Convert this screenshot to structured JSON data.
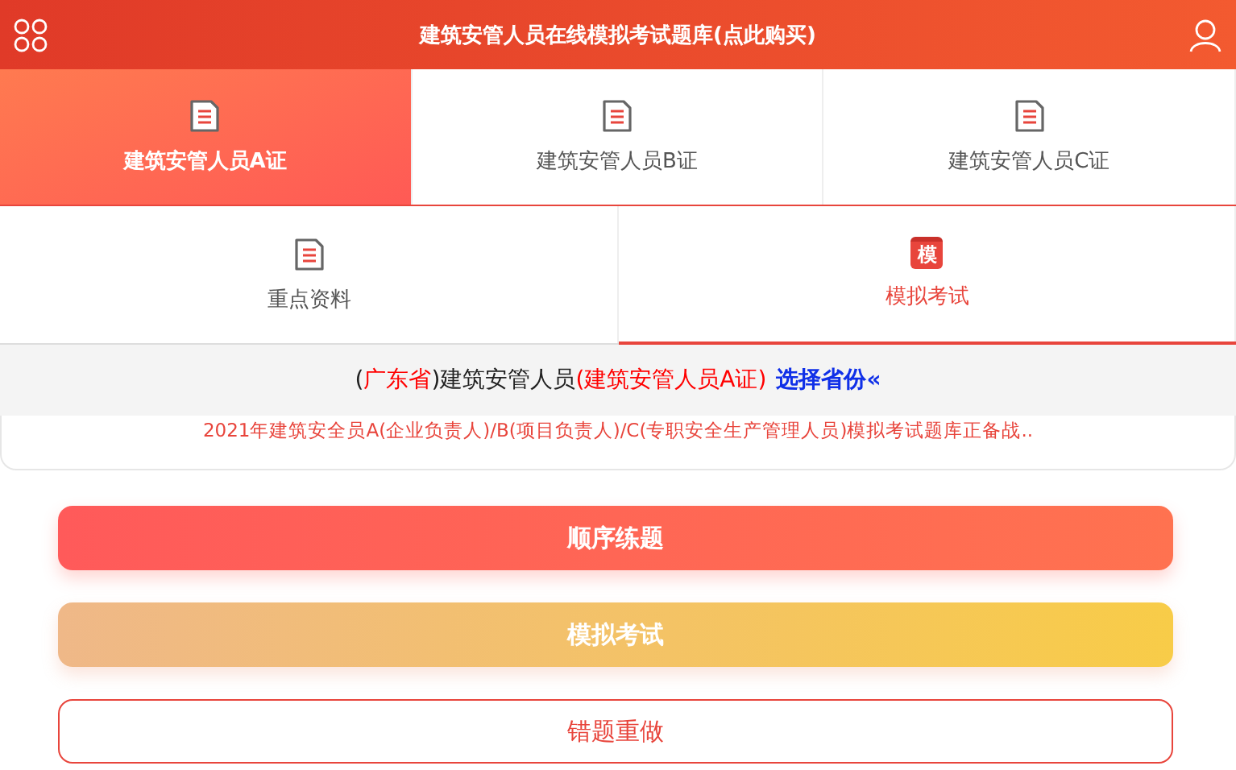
{
  "header": {
    "title": "建筑安管人员在线模拟考试题库(点此购买)"
  },
  "cert_tabs": [
    {
      "label": "建筑安管人员A证",
      "selected": true
    },
    {
      "label": "建筑安管人员B证",
      "selected": false
    },
    {
      "label": "建筑安管人员C证",
      "selected": false
    }
  ],
  "mode_tabs": [
    {
      "label": "重点资料",
      "selected": false,
      "kind": "doc"
    },
    {
      "label": "模拟考试",
      "selected": true,
      "kind": "exam",
      "badge": "模"
    }
  ],
  "province_line": [
    {
      "kind": "plain",
      "text": "("
    },
    {
      "kind": "highlight",
      "text": "广东省"
    },
    {
      "kind": "plain",
      "text": ")建筑安管人员"
    },
    {
      "kind": "highlight",
      "text": "(建筑安管人员A证)"
    },
    {
      "kind": "link",
      "text": "选择省份«"
    }
  ],
  "notice": "2021年建筑安全员A(企业负责人)/B(项目负责人)/C(专职安全生产管理人员)模拟考试题库正备战..",
  "buttons": [
    {
      "label": "顺序练题",
      "kind": "primary"
    },
    {
      "label": "模拟考试",
      "kind": "warm"
    },
    {
      "label": "错题重做",
      "kind": "outline"
    }
  ]
}
